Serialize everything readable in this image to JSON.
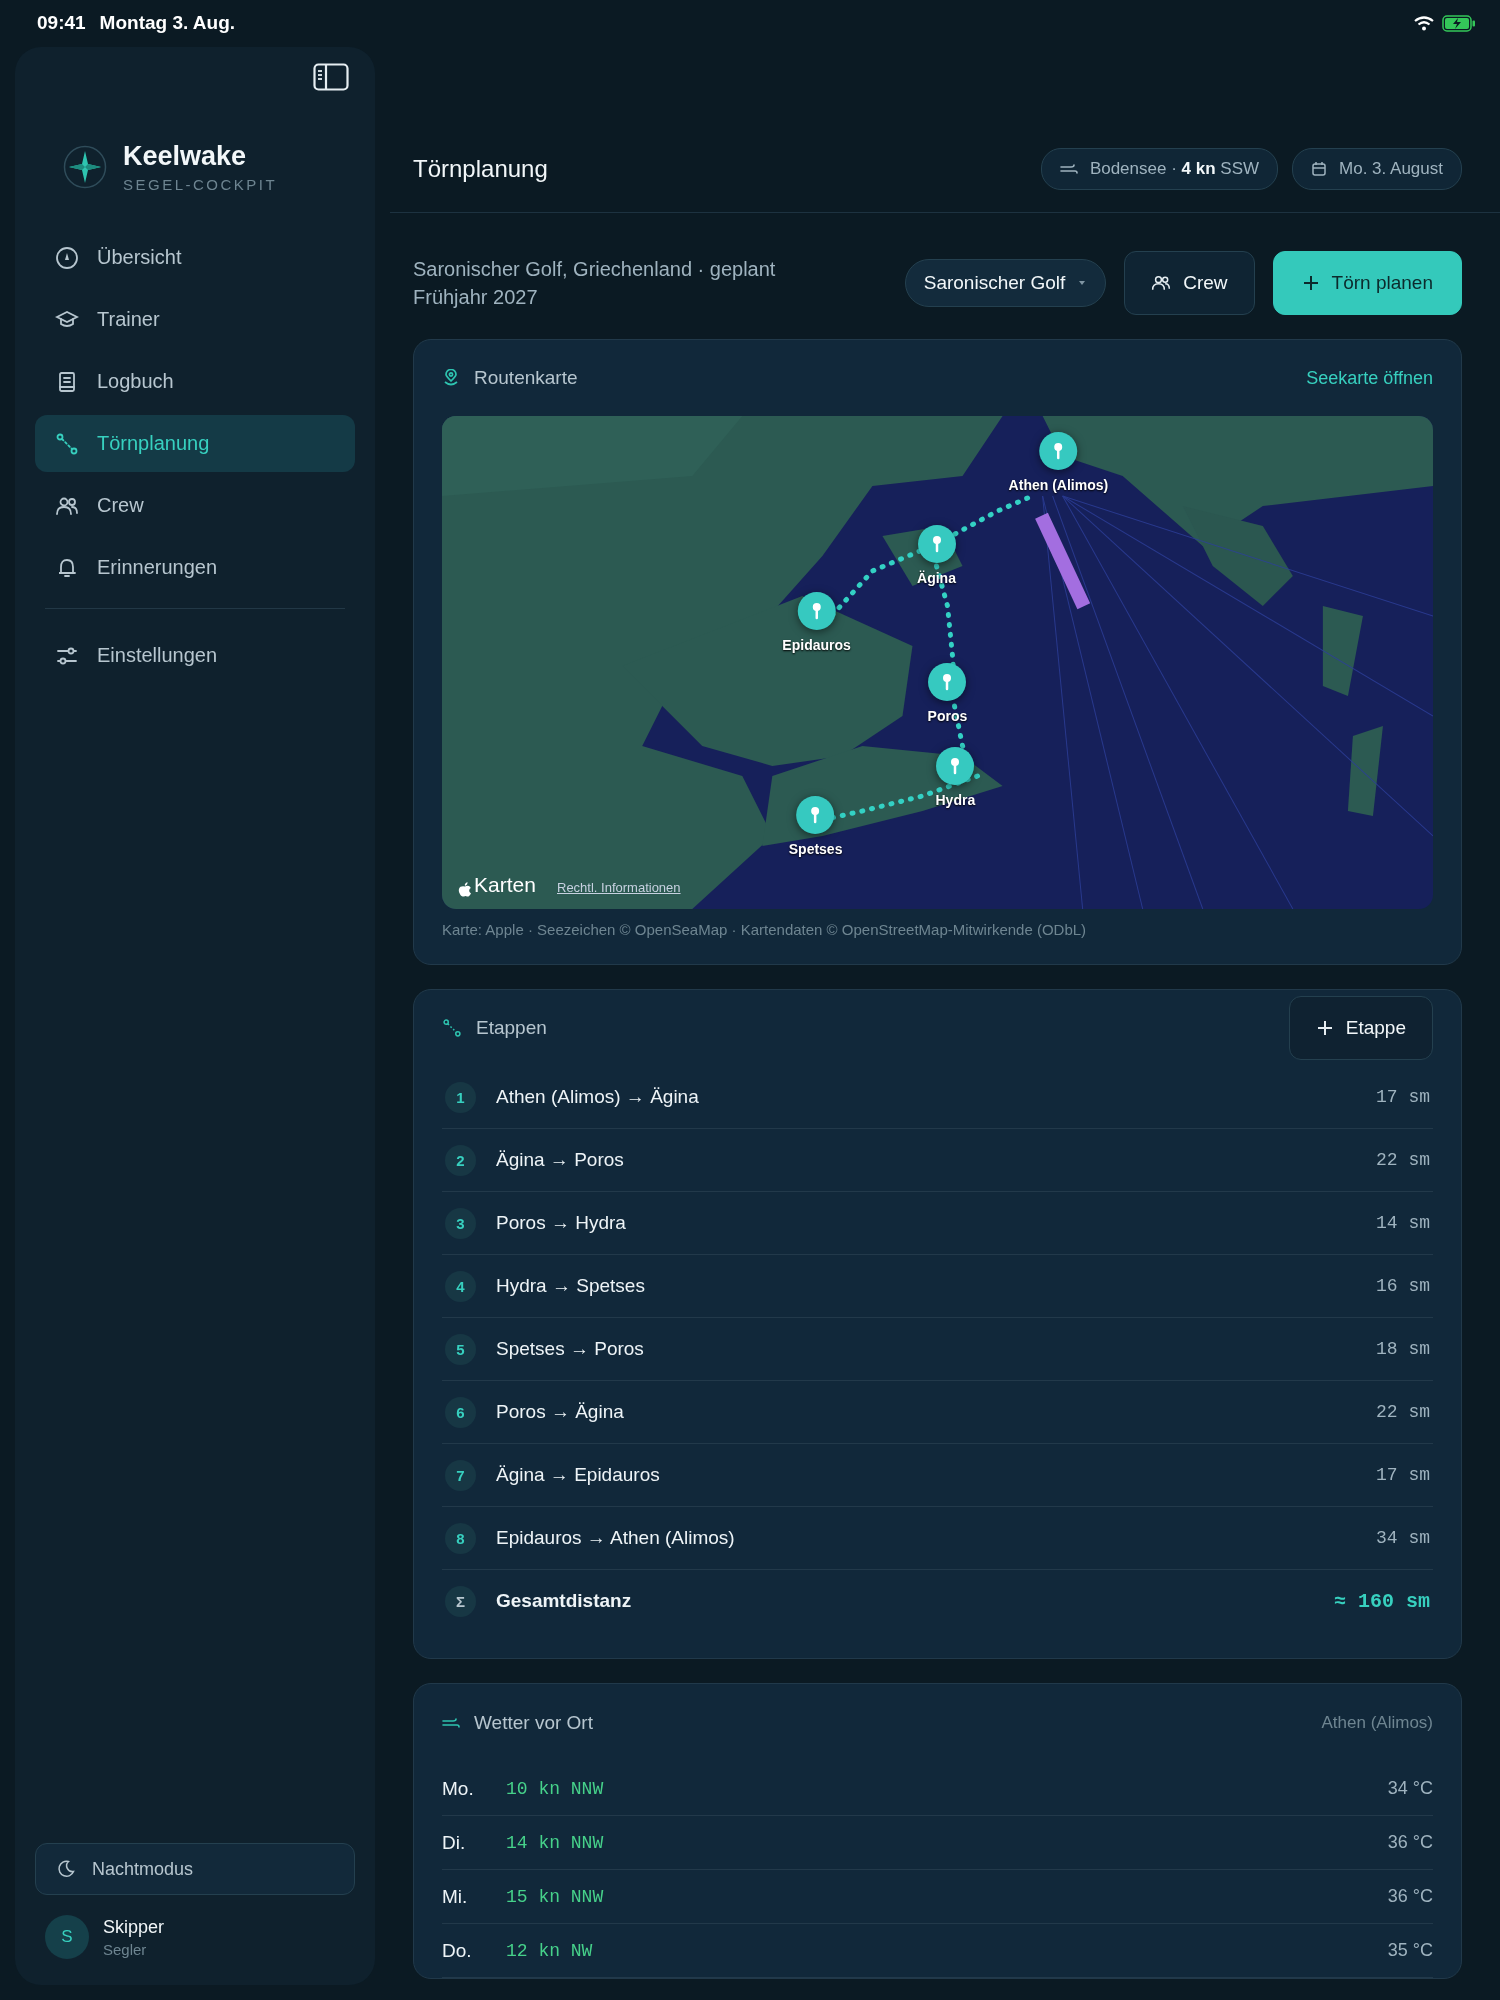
{
  "status_bar": {
    "time": "09:41",
    "date": "Montag 3. Aug."
  },
  "sidebar": {
    "brand": {
      "name": "Keelwake",
      "tagline": "SEGEL-COCKPIT"
    },
    "items": [
      {
        "label": "Übersicht",
        "selected": false
      },
      {
        "label": "Trainer",
        "selected": false
      },
      {
        "label": "Logbuch",
        "selected": false
      },
      {
        "label": "Törnplanung",
        "selected": true
      },
      {
        "label": "Crew",
        "selected": false
      },
      {
        "label": "Erinnerungen",
        "selected": false
      }
    ],
    "settings": {
      "label": "Einstellungen",
      "selected": false
    },
    "night_mode": {
      "label": "Nachtmodus"
    },
    "user": {
      "initial": "S",
      "name": "Skipper",
      "role": "Segler"
    }
  },
  "header": {
    "title": "Törnplanung",
    "wind_chip": {
      "place": "Bodensee ·",
      "speed": "4 kn",
      "direction": "SSW"
    },
    "date_chip": "Mo. 3. August"
  },
  "subheader": {
    "description": "Saronischer Golf, Griechenland · geplant Frühjahr 2027",
    "region_select": "Saronischer Golf",
    "crew_button": "Crew",
    "plan_button": "Törn planen"
  },
  "route_map": {
    "title": "Routenkarte",
    "link": "Seekarte öffnen",
    "pins": [
      {
        "label": "Athen (Alimos)"
      },
      {
        "label": "Ägina"
      },
      {
        "label": "Epidauros"
      },
      {
        "label": "Poros"
      },
      {
        "label": "Hydra"
      },
      {
        "label": "Spetses"
      }
    ],
    "logo": "Karten",
    "legal_link": "Rechtl. Informationen",
    "attribution": "Karte: Apple · Seezeichen © OpenSeaMap · Kartendaten © OpenStreetMap-Mitwirkende (ODbL)"
  },
  "stages": {
    "title": "Etappen",
    "add_button": "Etappe",
    "rows": [
      {
        "number": "1",
        "route": "Athen (Alimos) → Ägina",
        "distance": "17 sm"
      },
      {
        "number": "2",
        "route": "Ägina → Poros",
        "distance": "22 sm"
      },
      {
        "number": "3",
        "route": "Poros → Hydra",
        "distance": "14 sm"
      },
      {
        "number": "4",
        "route": "Hydra → Spetses",
        "distance": "16 sm"
      },
      {
        "number": "5",
        "route": "Spetses → Poros",
        "distance": "18 sm"
      },
      {
        "number": "6",
        "route": "Poros → Ägina",
        "distance": "22 sm"
      },
      {
        "number": "7",
        "route": "Ägina → Epidauros",
        "distance": "17 sm"
      },
      {
        "number": "8",
        "route": "Epidauros → Athen (Alimos)",
        "distance": "34 sm"
      }
    ],
    "total": {
      "symbol": "Σ",
      "label": "Gesamtdistanz",
      "distance": "≈ 160 sm"
    }
  },
  "weather": {
    "title": "Wetter vor Ort",
    "location": "Athen (Alimos)",
    "rows": [
      {
        "day": "Mo.",
        "wind": "10 kn NNW",
        "temperature": "34 °C"
      },
      {
        "day": "Di.",
        "wind": "14 kn NNW",
        "temperature": "36 °C"
      },
      {
        "day": "Mi.",
        "wind": "15 kn NNW",
        "temperature": "36 °C"
      },
      {
        "day": "Do.",
        "wind": "12 kn NW",
        "temperature": "35 °C"
      }
    ]
  }
}
